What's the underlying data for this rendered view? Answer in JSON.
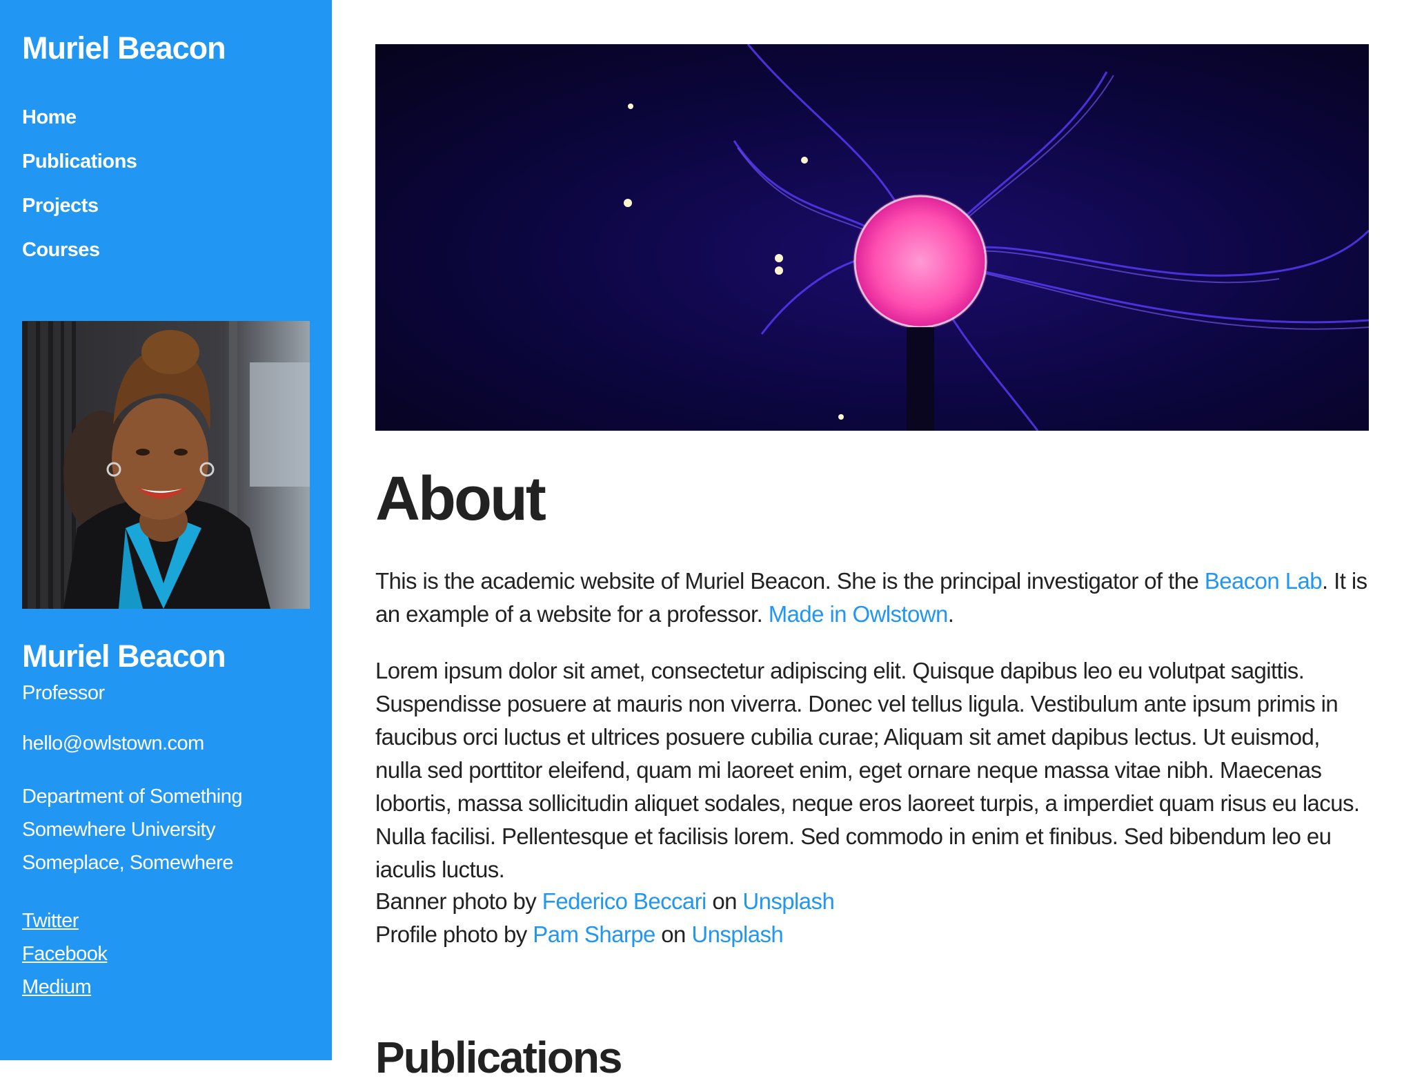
{
  "site": {
    "title": "Muriel Beacon"
  },
  "nav": {
    "items": [
      {
        "label": "Home"
      },
      {
        "label": "Publications"
      },
      {
        "label": "Projects"
      },
      {
        "label": "Courses"
      }
    ]
  },
  "profile": {
    "name": "Muriel Beacon",
    "role": "Professor",
    "email": "hello@owlstown.com",
    "address": [
      "Department of Something",
      "Somewhere University",
      "Someplace, Somewhere"
    ],
    "social": [
      "Twitter",
      "Facebook",
      "Medium"
    ]
  },
  "about": {
    "heading": "About",
    "p1_a": "This is the academic website of Muriel Beacon. She is the principal investigator of the ",
    "p1_link1": "Beacon Lab",
    "p1_b": ". It is an example of a website for a professor. ",
    "p1_link2": "Made in Owlstown",
    "p1_c": ".",
    "p2": "Lorem ipsum dolor sit amet, consectetur adipiscing elit. Quisque dapibus leo eu volutpat sagittis. Suspendisse posuere at mauris non viverra. Donec vel tellus ligula. Vestibulum ante ipsum primis in faucibus orci luctus et ultrices posuere cubilia curae; Aliquam sit amet dapibus lectus. Ut euismod, nulla sed porttitor eleifend, quam mi laoreet enim, eget ornare neque massa vitae nibh. Maecenas lobortis, massa sollicitudin aliquet sodales, neque eros laoreet turpis, a imperdiet quam risus eu lacus. Nulla facilisi. Pellentesque et facilisis lorem. Sed commodo in enim et finibus. Sed bibendum leo eu iaculis luctus.",
    "credit1_a": "Banner photo by ",
    "credit1_name": "Federico Beccari",
    "credit_on": " on ",
    "credit_site": "Unsplash",
    "credit2_a": "Profile photo by ",
    "credit2_name": "Pam Sharpe"
  },
  "publications": {
    "heading": "Publications"
  },
  "colors": {
    "accent": "#2196f3",
    "text": "#222222"
  }
}
